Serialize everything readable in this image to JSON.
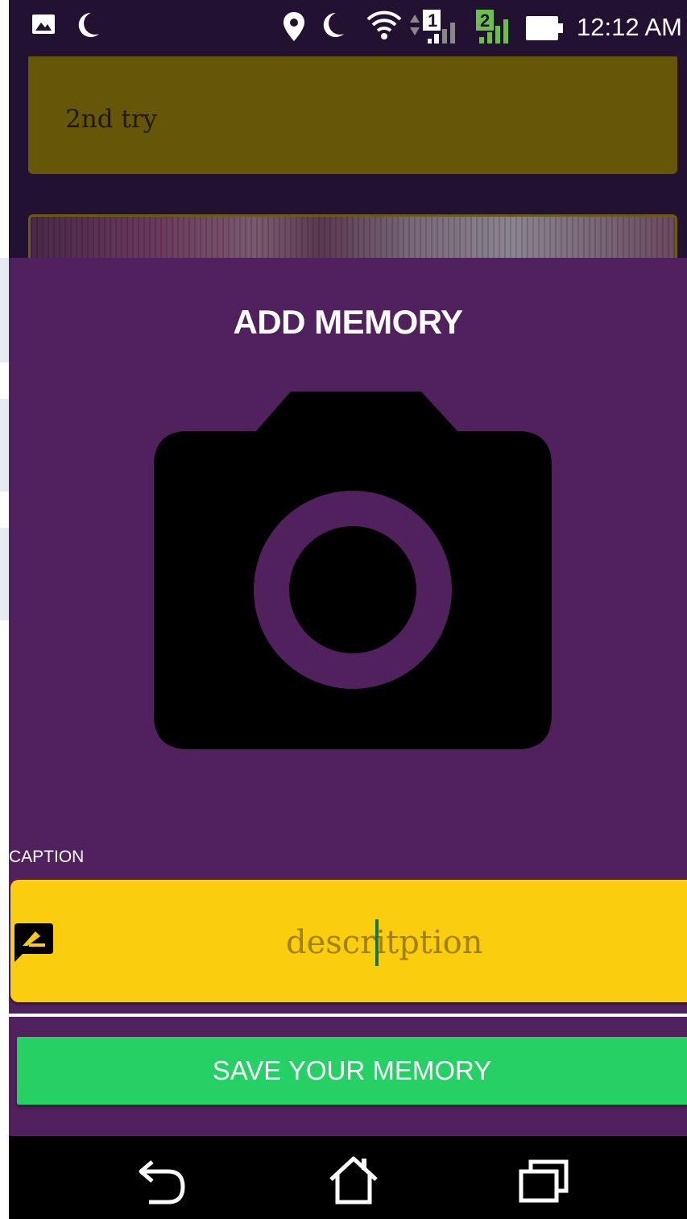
{
  "status_bar": {
    "time": "12:12 AM",
    "sim1": "1",
    "sim2": "2",
    "icons": [
      "gallery-icon",
      "moon-icon",
      "location-icon",
      "moon-icon",
      "wifi-icon",
      "signal-sim1-icon",
      "signal-sim2-icon",
      "battery-icon"
    ]
  },
  "background_list": {
    "card1_text": "2nd try"
  },
  "dialog": {
    "title": "ADD MEMORY",
    "camera_icon": "camera-icon",
    "caption_label": "CAPTION",
    "caption_value": "descritption",
    "caption_icon": "chat-edit-icon",
    "save_button": "SAVE YOUR MEMORY"
  },
  "nav_bar": {
    "icons": [
      "back-icon",
      "home-icon",
      "recents-icon"
    ]
  },
  "colors": {
    "dialog_bg": "#51215d",
    "field_bg": "#fbcd0f",
    "button_bg": "#25d165",
    "status_bg": "#221130"
  }
}
